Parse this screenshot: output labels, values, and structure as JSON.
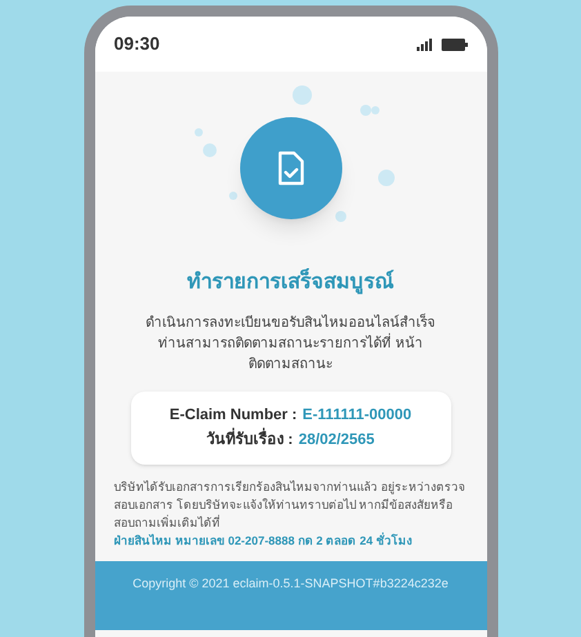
{
  "status_bar": {
    "time": "09:30"
  },
  "title": "ทำรายการเสร็จสมบูรณ์",
  "message": "ดำเนินการลงทะเบียนขอรับสินไหมออนไลน์สำเร็จ ท่านสามารถติดตามสถานะรายการได้ที่ หน้าติดตามสถานะ",
  "claim_card": {
    "rows": [
      {
        "label": "E-Claim Number :",
        "value": "E-111111-00000"
      },
      {
        "label": "วันที่รับเรื่อง :",
        "value": "28/02/2565"
      }
    ]
  },
  "notice": "บริษัทได้รับเอกสารการเรียกร้องสินไหมจากท่านแล้ว อยู่ระหว่างตรวจสอบเอกสาร โดยบริษัทจะแจ้งให้ท่านทราบต่อไป หากมีข้อสงสัยหรือสอบถามเพิ่มเติมได้ที่",
  "contact": "ฝ่ายสินไหม หมายเลข 02-207-8888 กด 2 ตลอด 24 ชั่วโมง",
  "footer": "Copyright © 2021 eclaim-0.5.1-SNAPSHOT#b3224c232e"
}
